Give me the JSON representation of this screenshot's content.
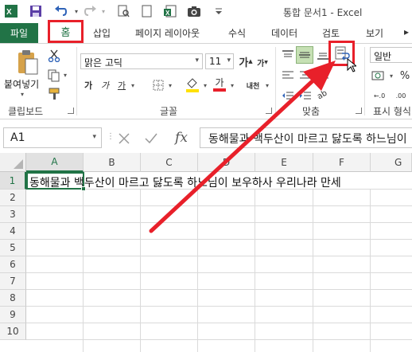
{
  "title_bar": {
    "document_title": "통합 문서1 - Excel",
    "quick_access": [
      "excel-logo-icon",
      "save-icon",
      "undo-icon",
      "redo-icon",
      "print-preview-icon",
      "new-doc-icon",
      "camera-icon",
      "customize-icon"
    ]
  },
  "tabs": {
    "file": "파일",
    "home": "홈",
    "insert": "삽입",
    "page_layout": "페이지 레이아웃",
    "formulas": "수식",
    "data": "데이터",
    "review": "검토",
    "view": "보기"
  },
  "ribbon": {
    "clipboard": {
      "paste": "붙여넣기",
      "group_label": "클립보드"
    },
    "font": {
      "font_name": "맑은 고딕",
      "font_size": "11",
      "bold": "가",
      "italic": "가",
      "underline": "가",
      "increase_size": "가",
      "decrease_size": "가",
      "font_color_glyph": "가",
      "phonetic": "내천",
      "group_label": "글꼴"
    },
    "alignment": {
      "group_label": "맞춤"
    },
    "number": {
      "format": "일반",
      "group_label": "표시 형식"
    }
  },
  "formula_bar": {
    "name_box": "A1",
    "fx": "fx",
    "content": "동해물과 백두산이 마르고 닳도록 하느님이"
  },
  "sheet": {
    "columns": [
      "A",
      "B",
      "C",
      "D",
      "E",
      "F",
      "G"
    ],
    "rows": [
      "1",
      "2",
      "3",
      "4",
      "5",
      "6",
      "7",
      "8",
      "9",
      "10"
    ],
    "a1_value": "동해물과 백두산이 마르고 닳도록 하느님이 보우하사 우리나라 만세"
  },
  "colors": {
    "excel_green": "#217346",
    "annotation_red": "#e8202a"
  }
}
